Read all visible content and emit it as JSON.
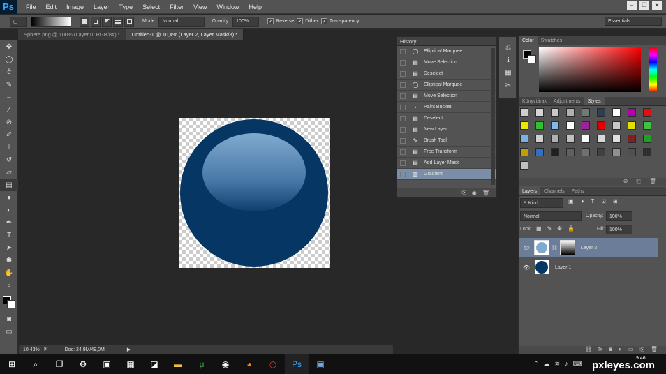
{
  "app": {
    "logo": "Ps"
  },
  "menu": [
    "File",
    "Edit",
    "Image",
    "Layer",
    "Type",
    "Select",
    "Filter",
    "View",
    "Window",
    "Help"
  ],
  "window_controls": {
    "minimize": "–",
    "restore": "❐",
    "close": "✕"
  },
  "options": {
    "mode_label": "Mode:",
    "mode_value": "Normal",
    "opacity_label": "Opacity:",
    "opacity_value": "100%",
    "reverse": "Reverse",
    "dither": "Dither",
    "transparency": "Transparency",
    "workspace": "Essentials"
  },
  "tabs": [
    {
      "label": "Sphere.png @ 100% (Layer 0, RGB/8#) *"
    },
    {
      "label": "Untitled-1 @ 10,4% (Layer 2, Layer Mask/8) *"
    }
  ],
  "tools": [
    "move-tool",
    "marquee-tool",
    "lasso-tool",
    "quick-select-tool",
    "crop-tool",
    "eyedropper-tool",
    "healing-tool",
    "brush-tool",
    "clone-stamp-tool",
    "history-brush-tool",
    "eraser-tool",
    "gradient-tool",
    "blur-tool",
    "dodge-tool",
    "pen-tool",
    "type-tool",
    "path-select-tool",
    "shape-tool",
    "hand-tool",
    "zoom-tool"
  ],
  "status": {
    "zoom": "10,43%",
    "doc": "Doc: 24,9M/49,0M"
  },
  "history": {
    "title": "History",
    "items": [
      {
        "label": "Elliptical Marquee",
        "icon": "ellipse-icon"
      },
      {
        "label": "Move Selection",
        "icon": "doc-icon"
      },
      {
        "label": "Deselect",
        "icon": "doc-icon"
      },
      {
        "label": "Elliptical Marquee",
        "icon": "ellipse-icon"
      },
      {
        "label": "Move Selection",
        "icon": "doc-icon"
      },
      {
        "label": "Paint Bucket",
        "icon": "bucket-icon"
      },
      {
        "label": "Deselect",
        "icon": "doc-icon"
      },
      {
        "label": "New Layer",
        "icon": "doc-icon"
      },
      {
        "label": "Brush Tool",
        "icon": "brush-icon"
      },
      {
        "label": "Free Transform",
        "icon": "doc-icon"
      },
      {
        "label": "Add Layer Mask",
        "icon": "doc-icon"
      },
      {
        "label": "Gradient",
        "icon": "gradient-icon",
        "active": true
      }
    ]
  },
  "color_panel": {
    "tabs": [
      "Color",
      "Swatches"
    ]
  },
  "styles_panel": {
    "tabs": [
      "Könyvtárak",
      "Adjustments",
      "Styles"
    ],
    "swatch_colors": [
      "#cfcfcf",
      "#d6d6d6",
      "#c8c8c8",
      "#b0b0b0",
      "#6e7a78",
      "#2a3f4f",
      "#ffffff",
      "#b000b0",
      "#e01010",
      "#e8e800",
      "#30c030",
      "#80b8f0",
      "#ffffff",
      "#a020a0",
      "#e00000",
      "#c8c8c8",
      "#e0e000",
      "#40c040",
      "#7ab0e8",
      "#d0d0d0",
      "#b0b0b0",
      "#c0c0c0",
      "#ffffff",
      "#d8d8d8",
      "#e0e0e0",
      "#802020",
      "#20a020",
      "#c0a000",
      "#3070c0",
      "#202020",
      "#606060",
      "#707070",
      "#404040",
      "#909090",
      "#505050",
      "#303030",
      "#c0c0c0"
    ]
  },
  "layers": {
    "tabs": [
      "Layers",
      "Channels",
      "Paths"
    ],
    "kind": "Kind",
    "blend": "Normal",
    "opacity_label": "Opacity:",
    "opacity": "100%",
    "lock_label": "Lock:",
    "fill_label": "Fill:",
    "fill": "100%",
    "items": [
      {
        "name": "Layer 2",
        "selected": true
      },
      {
        "name": "Layer 1",
        "selected": false
      }
    ]
  },
  "taskbar": {
    "icons": [
      "windows-icon",
      "search-icon",
      "task-view-icon",
      "settings-icon",
      "store-icon",
      "calculator-icon",
      "photos-icon",
      "explorer-icon",
      "utorrent-icon",
      "media-icon",
      "firefox-icon",
      "chrome-icon",
      "photoshop-icon",
      "app-icon"
    ],
    "clock": "9:46",
    "watermark": "pxleyes.com"
  },
  "colors": {
    "sphere": "#063764",
    "accent": "#31a8ff"
  }
}
